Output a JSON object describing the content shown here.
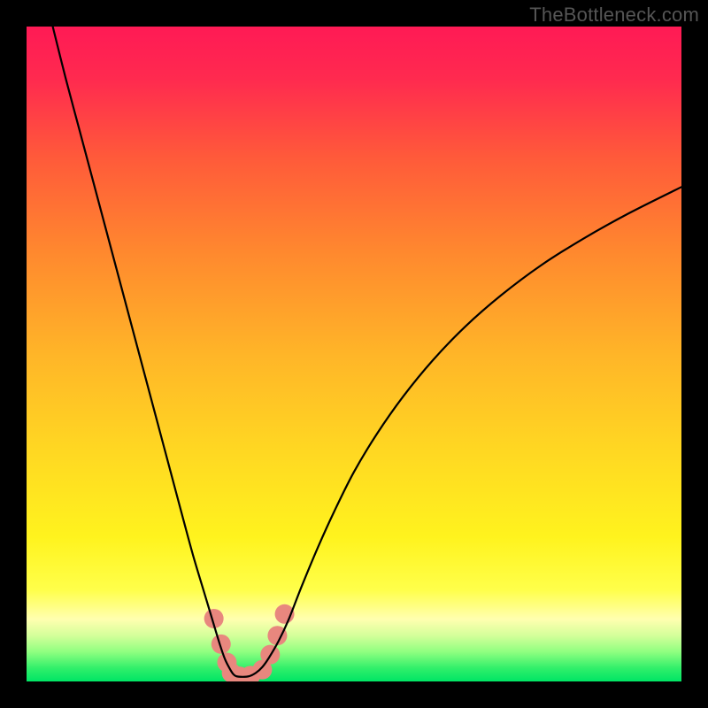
{
  "watermark": "TheBottleneck.com",
  "chart_data": {
    "type": "line",
    "title": "",
    "xlabel": "",
    "ylabel": "",
    "xlim": [
      0,
      100
    ],
    "ylim": [
      0,
      100
    ],
    "grid": false,
    "background_gradient_stops": [
      {
        "offset": 0.0,
        "color": "#ff1a55"
      },
      {
        "offset": 0.08,
        "color": "#ff2a4f"
      },
      {
        "offset": 0.2,
        "color": "#ff5a3a"
      },
      {
        "offset": 0.35,
        "color": "#ff8a2e"
      },
      {
        "offset": 0.5,
        "color": "#ffb528"
      },
      {
        "offset": 0.65,
        "color": "#ffd822"
      },
      {
        "offset": 0.78,
        "color": "#fff31e"
      },
      {
        "offset": 0.86,
        "color": "#ffff4a"
      },
      {
        "offset": 0.905,
        "color": "#ffffb0"
      },
      {
        "offset": 0.93,
        "color": "#d4ff9a"
      },
      {
        "offset": 0.955,
        "color": "#8fff80"
      },
      {
        "offset": 0.98,
        "color": "#30ef6a"
      },
      {
        "offset": 1.0,
        "color": "#00e565"
      }
    ],
    "series": [
      {
        "name": "bottleneck-curve",
        "color": "#000000",
        "stroke_width": 2.2,
        "x": [
          4,
          6,
          8,
          10,
          12,
          14,
          16,
          18,
          20,
          22,
          24,
          25.5,
          27,
          28.5,
          29.5,
          30.3,
          31,
          31.5,
          32,
          33,
          34,
          35,
          36,
          37,
          38.5,
          40,
          42,
          44.5,
          47,
          50,
          53.5,
          57.5,
          62,
          67,
          72.5,
          78.5,
          85,
          92,
          100
        ],
        "y": [
          100,
          92,
          84.5,
          77,
          69.5,
          62,
          54.5,
          47,
          39.5,
          32,
          24.5,
          19,
          14,
          9,
          5.7,
          3.4,
          2.0,
          1.2,
          0.8,
          0.7,
          0.8,
          1.3,
          2.2,
          3.6,
          6.2,
          9.4,
          14.5,
          20.5,
          26.0,
          32.0,
          37.8,
          43.5,
          49.0,
          54.2,
          59.0,
          63.5,
          67.6,
          71.5,
          75.5
        ]
      }
    ],
    "markers": {
      "name": "recommended-range-markers",
      "color": "#e8877e",
      "radius": 11,
      "points": [
        {
          "x": 28.6,
          "y": 9.6
        },
        {
          "x": 29.7,
          "y": 5.7
        },
        {
          "x": 30.6,
          "y": 2.9
        },
        {
          "x": 31.3,
          "y": 1.3
        },
        {
          "x": 32.5,
          "y": 0.8
        },
        {
          "x": 34.2,
          "y": 0.9
        },
        {
          "x": 36.0,
          "y": 1.8
        },
        {
          "x": 37.2,
          "y": 4.1
        },
        {
          "x": 38.3,
          "y": 7.0
        },
        {
          "x": 39.4,
          "y": 10.3
        }
      ]
    }
  }
}
